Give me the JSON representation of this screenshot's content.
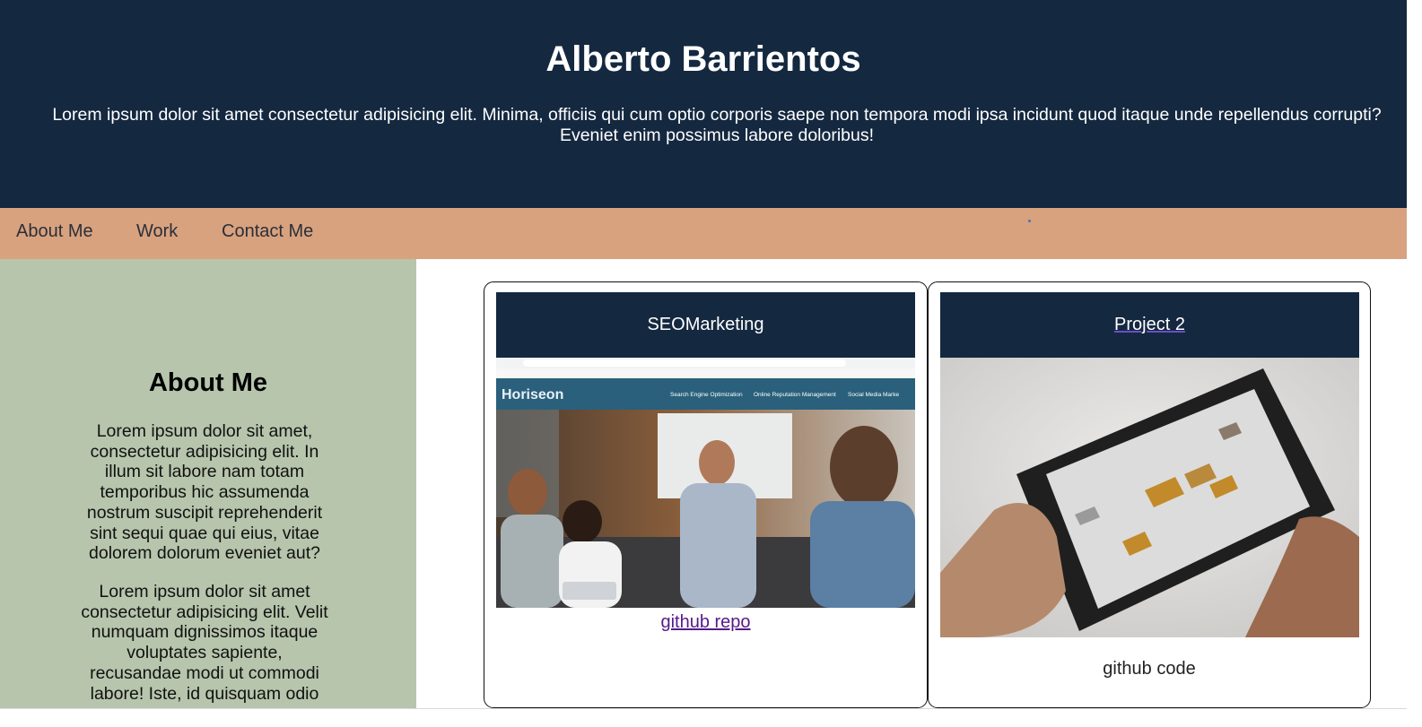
{
  "header": {
    "title": "Alberto Barrientos",
    "tagline": "Lorem ipsum dolor sit amet consectetur adipisicing elit. Minima, officiis qui cum optio corporis saepe non tempora modi ipsa incidunt quod itaque unde repellendus corrupti? Eveniet enim possimus labore doloribus!"
  },
  "nav": {
    "items": [
      {
        "label": "About Me"
      },
      {
        "label": "Work"
      },
      {
        "label": "Contact Me"
      }
    ]
  },
  "about": {
    "heading": "About Me",
    "paragraphs": [
      "Lorem ipsum dolor sit amet, consectetur adipisicing elit. In illum sit labore nam totam temporibus hic assumenda nostrum suscipit reprehenderit sint sequi quae qui eius, vitae dolorem dolorum eveniet aut?",
      "Lorem ipsum dolor sit amet consectetur adipisicing elit. Velit numquam dignissimos itaque voluptates sapiente, recusandae modi ut commodi labore! Iste, id quisquam odio"
    ]
  },
  "projects": [
    {
      "title": "SEOMarketing",
      "link_label": "github repo",
      "screenshot": {
        "brand": "Horiseon",
        "nav_items": [
          "Search Engine Optimization",
          "Online Reputation Management",
          "Social Media Marke"
        ]
      }
    },
    {
      "title": "Project 2",
      "link_label": "github code"
    }
  ],
  "colors": {
    "header_bg": "#142840",
    "nav_bg": "#d8a27e",
    "sidebar_bg": "#b6c5ac",
    "link_visited": "#551a8b"
  }
}
